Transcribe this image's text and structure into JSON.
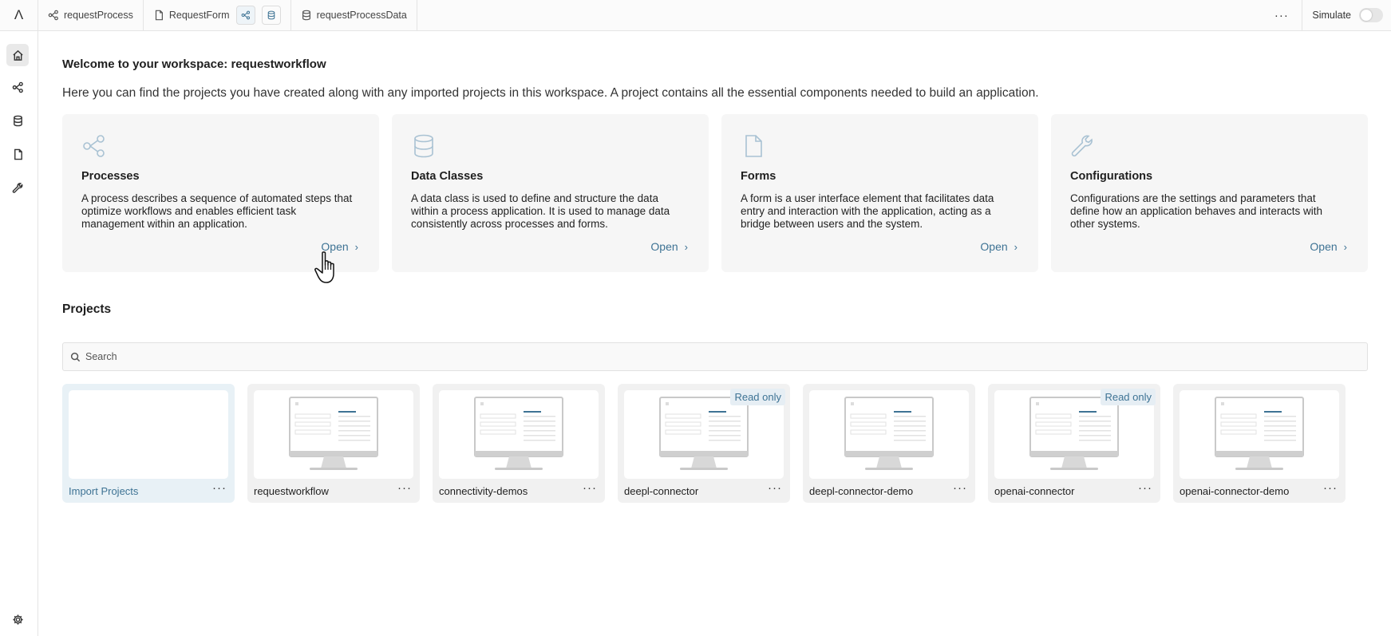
{
  "topbar": {
    "logo": "Λ",
    "tabs": [
      {
        "label": "requestProcess",
        "icon": "process-icon"
      },
      {
        "label": "RequestForm",
        "icon": "file-icon"
      },
      {
        "label": "requestProcessData",
        "icon": "database-icon"
      }
    ],
    "more": "···",
    "simulate_label": "Simulate"
  },
  "sidebar": {
    "items": [
      {
        "name": "home-icon",
        "active": true
      },
      {
        "name": "process-icon"
      },
      {
        "name": "database-icon"
      },
      {
        "name": "file-icon"
      },
      {
        "name": "wrench-icon"
      },
      {
        "name": "gear-icon"
      }
    ]
  },
  "main": {
    "welcome": "Welcome to your workspace: requestworkflow",
    "intro": "Here you can find the projects you have created along with any imported projects in this workspace. A project contains all the essential components needed to build an application.",
    "cards": [
      {
        "title": "Processes",
        "icon": "process-icon",
        "description": "A process describes a sequence of automated steps that optimize workflows and enables efficient task management within an application.",
        "open": "Open"
      },
      {
        "title": "Data Classes",
        "icon": "database-icon",
        "description": "A data class is used to define and structure the data within a process application. It is used to manage data consistently across processes and forms.",
        "open": "Open"
      },
      {
        "title": "Forms",
        "icon": "file-icon",
        "description": "A form is a user interface element that facilitates data entry and interaction with the application, acting as a bridge between users and the system.",
        "open": "Open"
      },
      {
        "title": "Configurations",
        "icon": "wrench-icon",
        "description": "Configurations are the settings and parameters that define how an application behaves and interacts with other systems.",
        "open": "Open"
      }
    ],
    "projects_title": "Projects",
    "search_placeholder": "Search",
    "projects": [
      {
        "name": "Import Projects",
        "read_only": false
      },
      {
        "name": "requestworkflow",
        "read_only": false
      },
      {
        "name": "connectivity-demos",
        "read_only": false
      },
      {
        "name": "deepl-connector",
        "read_only": true
      },
      {
        "name": "deepl-connector-demo",
        "read_only": false
      },
      {
        "name": "openai-connector",
        "read_only": true
      },
      {
        "name": "openai-connector-demo",
        "read_only": false
      }
    ],
    "read_only_label": "Read only",
    "more": "···"
  },
  "colors": {
    "accent": "#3e7394",
    "icon_light": "#a9c2d3",
    "card_bg": "#f6f6f6",
    "import_bg": "#e8f1f6"
  }
}
